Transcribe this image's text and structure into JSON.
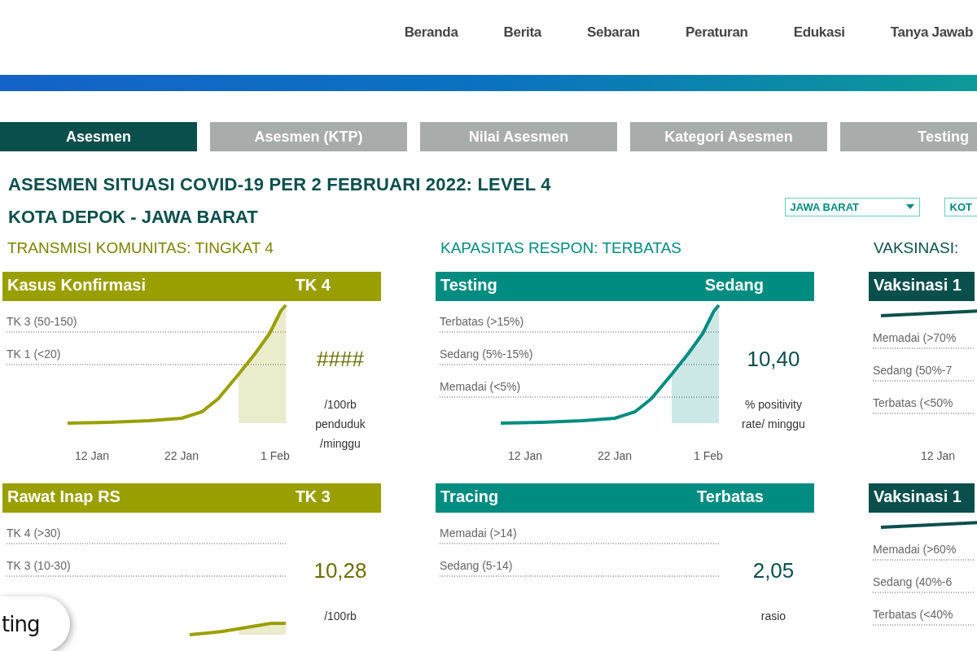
{
  "nav": {
    "items": [
      {
        "label": "Beranda"
      },
      {
        "label": "Berita"
      },
      {
        "label": "Sebaran"
      },
      {
        "label": "Peraturan"
      },
      {
        "label": "Edukasi"
      },
      {
        "label": "Tanya Jawab"
      }
    ]
  },
  "tabs": [
    {
      "label": "Asesmen",
      "selected": true
    },
    {
      "label": "Asesmen (KTP)",
      "selected": false
    },
    {
      "label": "Nilai Asesmen",
      "selected": false
    },
    {
      "label": "Kategori Asesmen",
      "selected": false
    },
    {
      "label": "Testing",
      "selected": false
    }
  ],
  "title": "ASESMEN SITUASI COVID-19 PER 2 FEBRUARI 2022: LEVEL 4",
  "subtitle": "KOTA DEPOK - JAWA BARAT",
  "filters": [
    {
      "value": "JAWA BARAT"
    },
    {
      "value": "KOT"
    }
  ],
  "columns": [
    {
      "heading": "TRANSMISI KOMUNITAS: TINGKAT 4",
      "color": "#9a9f00",
      "cards": [
        {
          "kind": "rising",
          "title": "Kasus Konfirmasi",
          "status": "TK  4",
          "thresholds": [
            "TK 3 (50-150)",
            "TK 1 (<20)"
          ],
          "value": "####",
          "unit": "/100rb penduduk /minggu",
          "dates": [
            "12 Jan",
            "22 Jan",
            "1 Feb"
          ]
        },
        {
          "kind": "gentle",
          "title": "Rawat Inap RS",
          "status": "TK  3",
          "thresholds": [
            "TK 4 (>30)",
            "TK 3 (10-30)"
          ],
          "value": "10,28",
          "unit": "/100rb"
        }
      ]
    },
    {
      "heading": "KAPASITAS RESPON: TERBATAS",
      "color": "#008c80",
      "cards": [
        {
          "kind": "rising",
          "title": "Testing",
          "status": "Sedang",
          "thresholds": [
            "Terbatas (>15%)",
            "Sedang (5%-15%)",
            "Memadai (<5%)"
          ],
          "value": "10,40",
          "unit": "% positivity rate/ minggu",
          "dates": [
            "12 Jan",
            "22 Jan",
            "1 Feb"
          ]
        },
        {
          "kind": "none",
          "title": "Tracing",
          "status": "Terbatas",
          "thresholds": [
            "Memadai (>14)",
            "Sedang (5-14)"
          ],
          "value": "2,05",
          "unit": "rasio"
        }
      ]
    },
    {
      "heading": "VAKSINASI:",
      "color": "#0b4f4c",
      "cards": [
        {
          "kind": "flat",
          "title": "Vaksinasi 1",
          "thresholds": [
            "Memadai (>70%",
            "Sedang (50%-7",
            "Terbatas (<50%"
          ],
          "dates": [
            "12 Jan"
          ]
        },
        {
          "kind": "flat",
          "title": "Vaksinasi 1",
          "thresholds": [
            "Memadai (>60%",
            "Sedang (40%-6",
            "Terbatas (<40%"
          ]
        }
      ]
    }
  ],
  "floating_button": {
    "label": "ting"
  }
}
